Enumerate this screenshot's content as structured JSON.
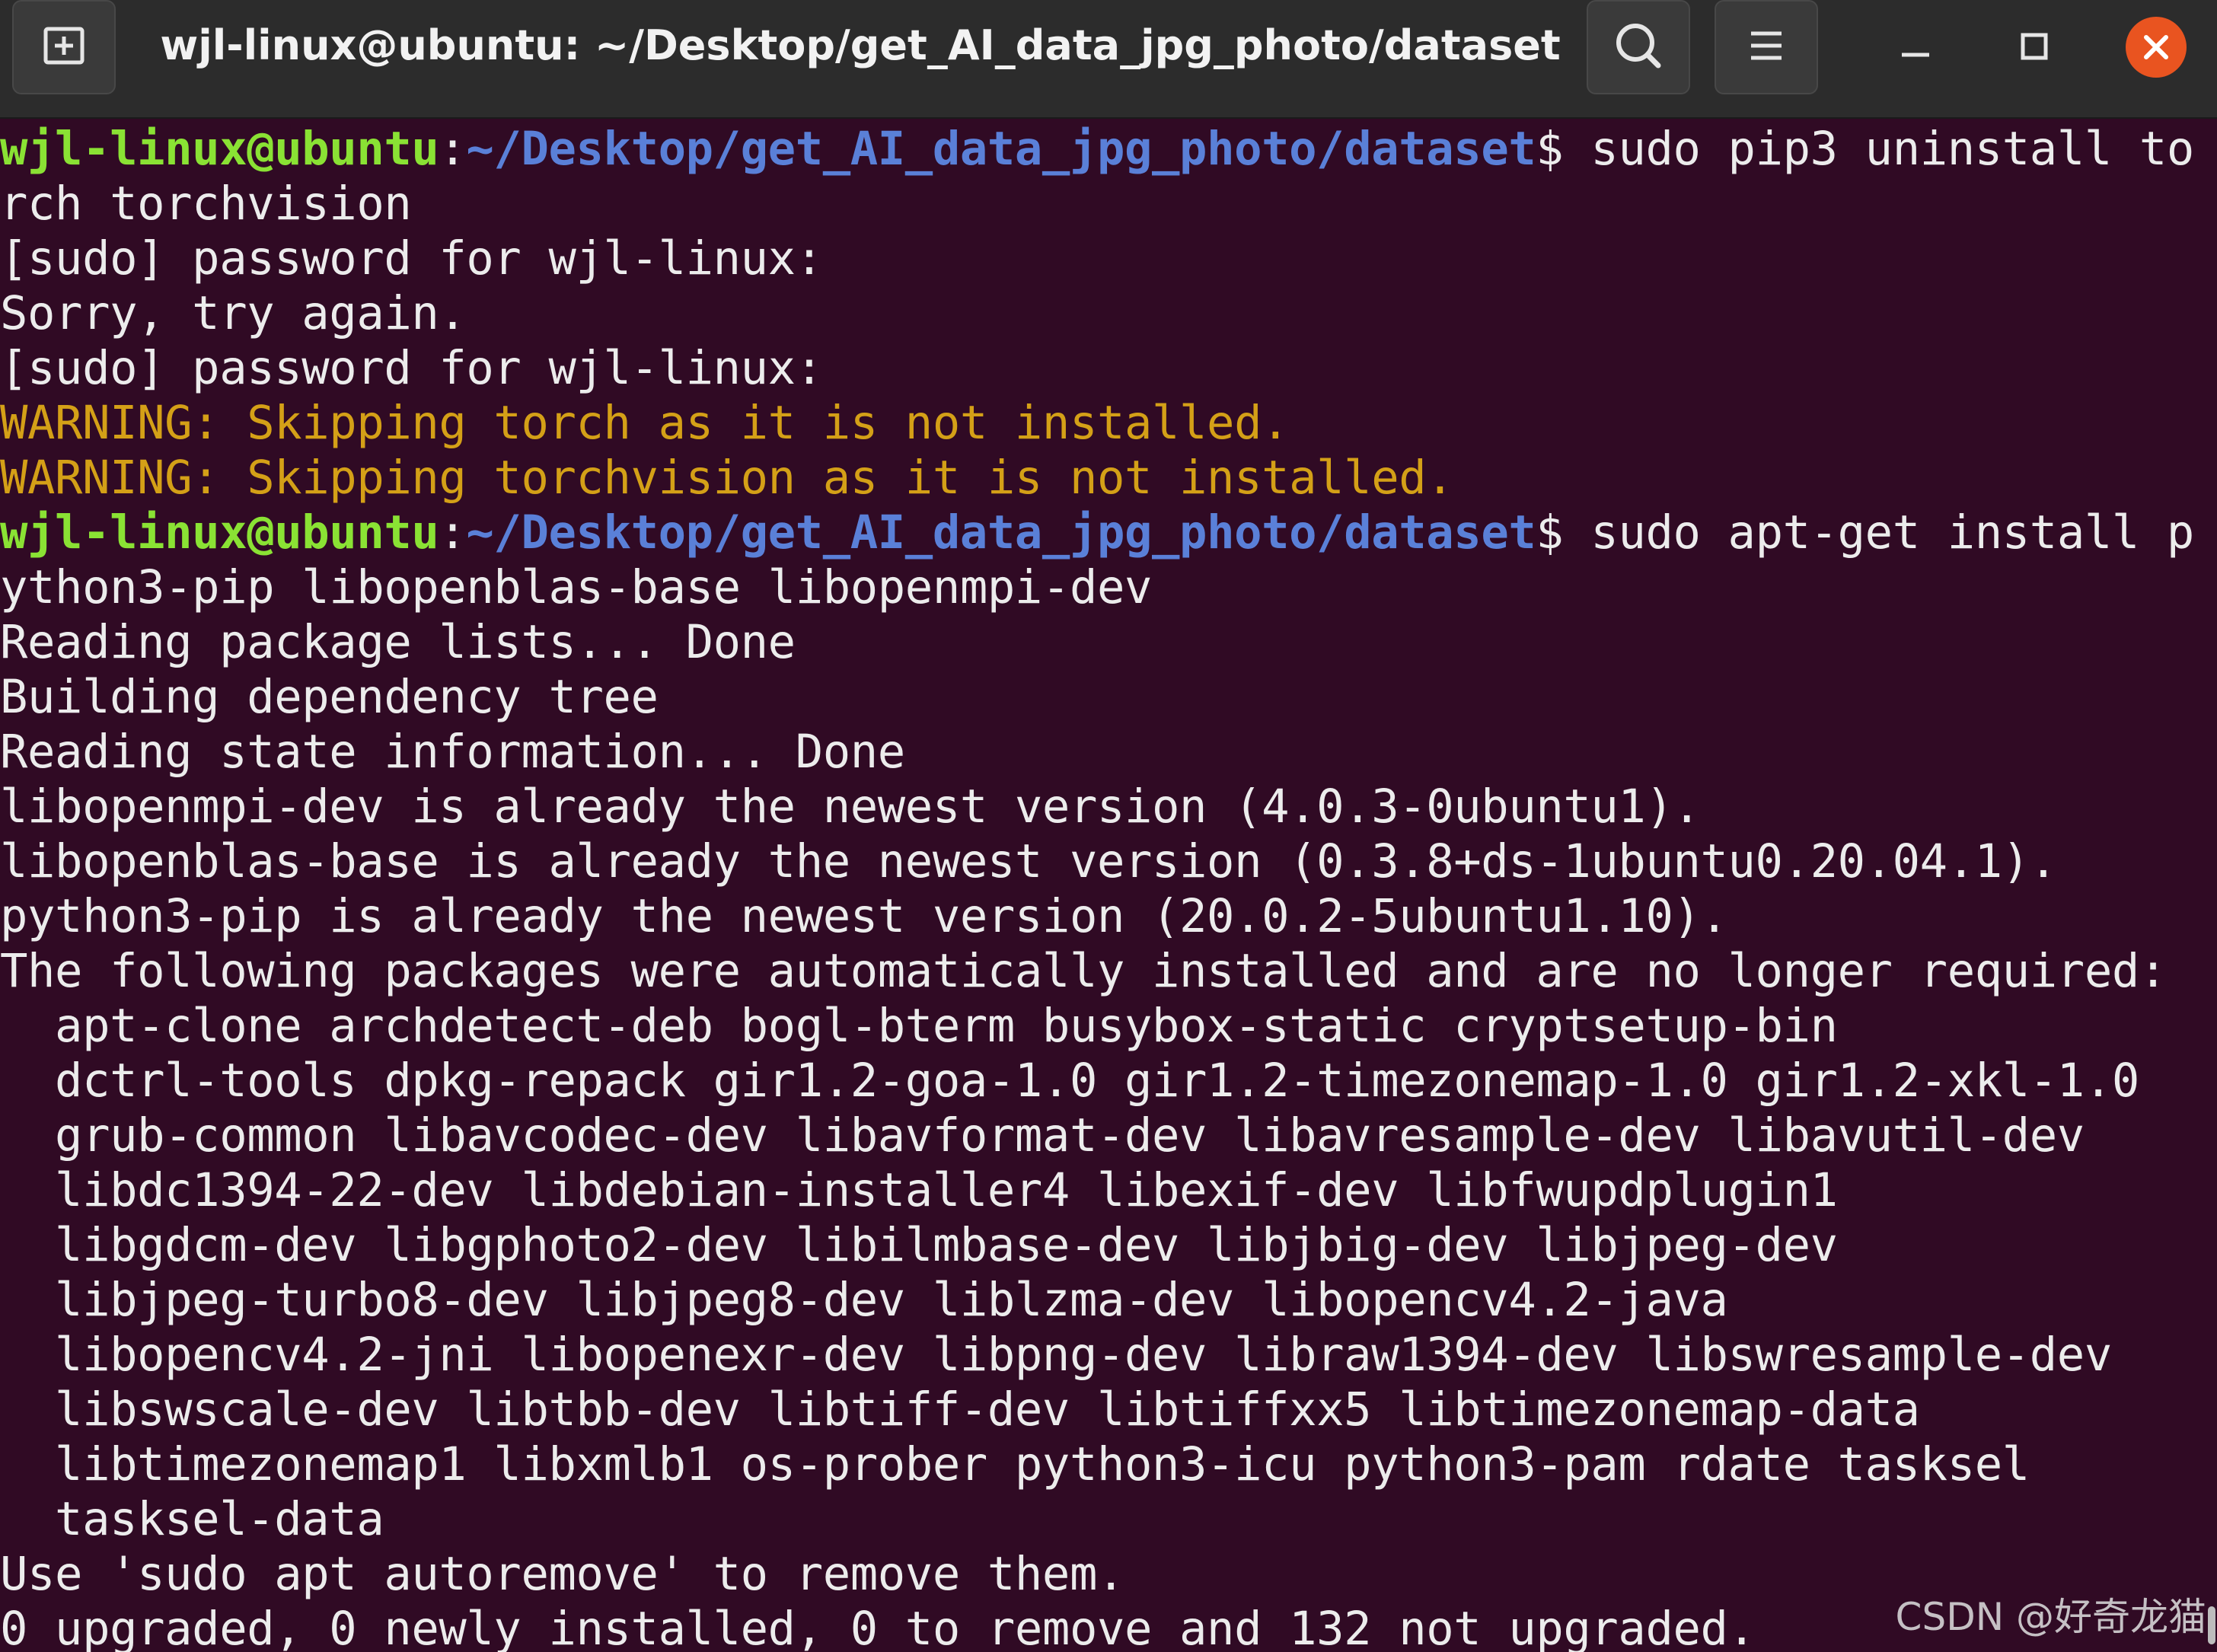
{
  "window": {
    "title": "wjl-linux@ubuntu: ~/Desktop/get_AI_data_jpg_photo/dataset",
    "titlebar_color": "#2c2c2c",
    "background_color": "#300a24",
    "buttons": {
      "new_tab_icon": "new-tab-icon",
      "search_icon": "search-icon",
      "menu_icon": "hamburger-menu-icon",
      "minimize_icon": "minimize-icon",
      "maximize_icon": "maximize-icon",
      "close_icon": "close-icon",
      "close_color": "#e95420"
    }
  },
  "colors": {
    "prompt_user": "#8ae234",
    "prompt_path": "#5a80d8",
    "warning": "#d4a017",
    "text": "#ececec"
  },
  "terminal": {
    "lines": [
      {
        "user": "wjl-linux@ubuntu",
        "sep": ":",
        "path": "~/Desktop/get_AI_data_jpg_photo/dataset",
        "cmd": "$ sudo pip3 uninstall to"
      },
      {
        "text": "rch torchvision"
      },
      {
        "text": "[sudo] password for wjl-linux:"
      },
      {
        "text": "Sorry, try again."
      },
      {
        "text": "[sudo] password for wjl-linux:"
      },
      {
        "warn": "WARNING: Skipping torch as it is not installed."
      },
      {
        "warn": "WARNING: Skipping torchvision as it is not installed."
      },
      {
        "user": "wjl-linux@ubuntu",
        "sep": ":",
        "path": "~/Desktop/get_AI_data_jpg_photo/dataset",
        "cmd": "$ sudo apt-get install p"
      },
      {
        "text": "ython3-pip libopenblas-base libopenmpi-dev"
      },
      {
        "text": "Reading package lists... Done"
      },
      {
        "text": "Building dependency tree"
      },
      {
        "text": "Reading state information... Done"
      },
      {
        "text": "libopenmpi-dev is already the newest version (4.0.3-0ubuntu1)."
      },
      {
        "text": "libopenblas-base is already the newest version (0.3.8+ds-1ubuntu0.20.04.1)."
      },
      {
        "text": "python3-pip is already the newest version (20.0.2-5ubuntu1.10)."
      },
      {
        "text": "The following packages were automatically installed and are no longer required:"
      },
      {
        "text": "  apt-clone archdetect-deb bogl-bterm busybox-static cryptsetup-bin"
      },
      {
        "text": "  dctrl-tools dpkg-repack gir1.2-goa-1.0 gir1.2-timezonemap-1.0 gir1.2-xkl-1.0"
      },
      {
        "text": "  grub-common libavcodec-dev libavformat-dev libavresample-dev libavutil-dev"
      },
      {
        "text": "  libdc1394-22-dev libdebian-installer4 libexif-dev libfwupdplugin1"
      },
      {
        "text": "  libgdcm-dev libgphoto2-dev libilmbase-dev libjbig-dev libjpeg-dev"
      },
      {
        "text": "  libjpeg-turbo8-dev libjpeg8-dev liblzma-dev libopencv4.2-java"
      },
      {
        "text": "  libopencv4.2-jni libopenexr-dev libpng-dev libraw1394-dev libswresample-dev"
      },
      {
        "text": "  libswscale-dev libtbb-dev libtiff-dev libtiffxx5 libtimezonemap-data"
      },
      {
        "text": "  libtimezonemap1 libxmlb1 os-prober python3-icu python3-pam rdate tasksel"
      },
      {
        "text": "  tasksel-data"
      },
      {
        "text": "Use 'sudo apt autoremove' to remove them."
      },
      {
        "text": "0 upgraded, 0 newly installed, 0 to remove and 132 not upgraded."
      }
    ]
  },
  "watermark": {
    "text": "CSDN @好奇龙猫"
  }
}
